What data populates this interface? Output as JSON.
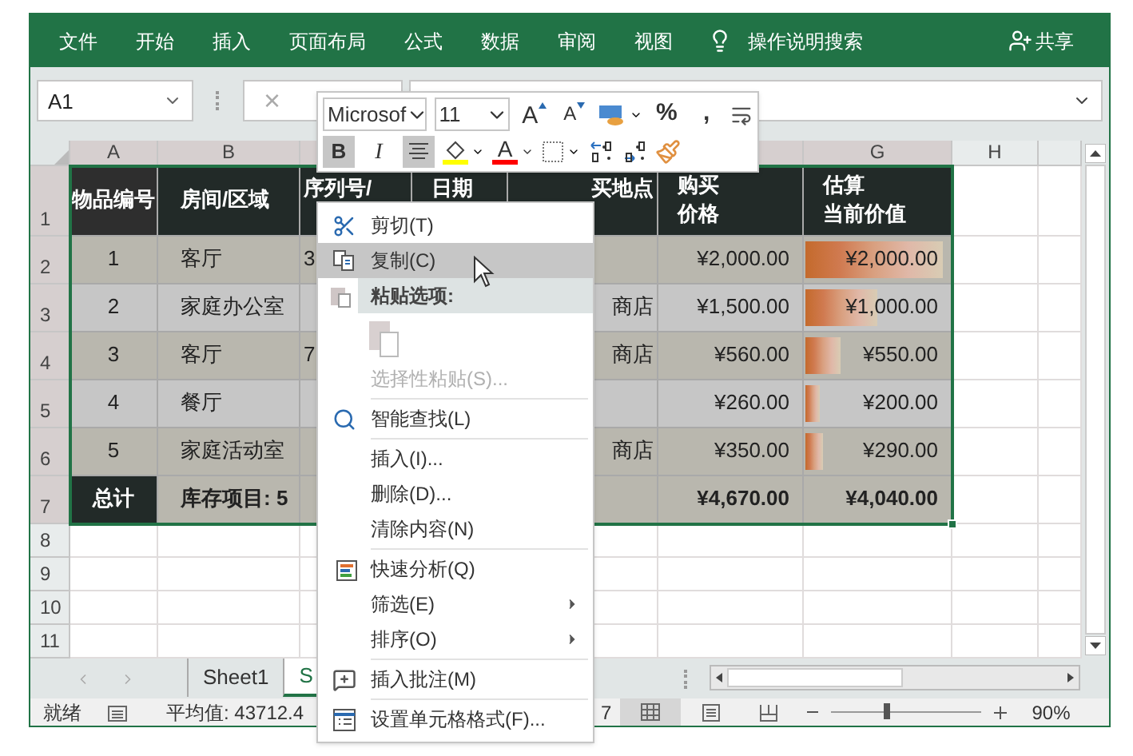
{
  "ribbon": {
    "tabs": [
      "文件",
      "开始",
      "插入",
      "页面布局",
      "公式",
      "数据",
      "审阅",
      "视图"
    ],
    "search": "操作说明搜索",
    "share": "共享"
  },
  "formula_bar": {
    "name_box": "A1",
    "cancel": "×"
  },
  "mini_toolbar": {
    "font": "Microsof",
    "size": "11",
    "row1": [
      {
        "kind": "grow",
        "text": "A"
      },
      {
        "kind": "shrink",
        "text": "A"
      },
      {
        "kind": "accounting"
      },
      {
        "kind": "text",
        "text": "%"
      },
      {
        "kind": "text",
        "text": ","
      },
      {
        "kind": "wrap"
      }
    ],
    "row2": [
      {
        "kind": "bold",
        "text": "B",
        "selected": true
      },
      {
        "kind": "italic",
        "text": "I",
        "selected": false
      },
      {
        "kind": "align",
        "selected": true
      },
      {
        "kind": "fill"
      },
      {
        "kind": "font_color",
        "text": "A"
      },
      {
        "kind": "border"
      },
      {
        "kind": "decrease_decimal"
      },
      {
        "kind": "increase_decimal"
      },
      {
        "kind": "painter"
      }
    ]
  },
  "sheet": {
    "column_headers": [
      "A",
      "B",
      "G",
      "H"
    ],
    "row_numbers": [
      "1",
      "2",
      "3",
      "4",
      "5",
      "6",
      "7",
      "8",
      "9",
      "10",
      "11"
    ],
    "table": {
      "header": {
        "item": "物品编号",
        "room": "房间/区域",
        "column_3": "序列号/",
        "column_4": "日期",
        "column_5": "买地点",
        "price": [
          "购买",
          "价格"
        ],
        "value": [
          "估算",
          "当前价值"
        ]
      },
      "rows": [
        {
          "kind": "data",
          "item": "1",
          "room": "客厅",
          "column_3": "3",
          "price": "¥2,000.00",
          "value": "¥2,000.00",
          "level": 1
        },
        {
          "kind": "data",
          "item": "2",
          "room": "家庭办公室",
          "column_5": "商店",
          "price": "¥1,500.00",
          "value": "¥1,000.00",
          "level": 0.52
        },
        {
          "kind": "data",
          "item": "3",
          "room": "客厅",
          "column_3": "7",
          "column_5": "商店",
          "price": "¥560.00",
          "value": "¥550.00",
          "level": 0.26
        },
        {
          "kind": "data",
          "item": "4",
          "room": "餐厅",
          "price": "¥260.00",
          "value": "¥200.00",
          "level": 0.1
        },
        {
          "kind": "data",
          "item": "5",
          "room": "家庭活动室",
          "column_5": "商店",
          "price": "¥350.00",
          "value": "¥290.00",
          "level": 0.13
        },
        {
          "kind": "total",
          "item": "总计",
          "room": "库存项目: 5",
          "price": "¥4,670.00",
          "value": "¥4,040.00"
        }
      ]
    }
  },
  "sheet_tabs": [
    {
      "label": "Sheet1",
      "selected": false
    },
    {
      "label": "S",
      "selected": true
    }
  ],
  "context_menu": [
    {
      "kind": "cut",
      "label": "剪切(T)",
      "selected": false,
      "disabled": false
    },
    {
      "kind": "copy",
      "label": "复制(C)",
      "selected": true,
      "disabled": false
    },
    {
      "kind": "paste_header",
      "label": "粘贴选项:"
    },
    {
      "kind": "paste_button",
      "disabled": true
    },
    {
      "kind": "plain",
      "label": "选择性粘贴(S)...",
      "selected": false,
      "disabled": true
    },
    {
      "kind": "separator"
    },
    {
      "kind": "lookup",
      "label": "智能查找(L)",
      "selected": false,
      "disabled": false
    },
    {
      "kind": "separator"
    },
    {
      "kind": "plain",
      "label": "插入(I)...",
      "selected": false,
      "disabled": false
    },
    {
      "kind": "plain",
      "label": "删除(D)...",
      "selected": false,
      "disabled": false
    },
    {
      "kind": "plain",
      "label": "清除内容(N)",
      "selected": false,
      "disabled": false
    },
    {
      "kind": "separator"
    },
    {
      "kind": "analysis",
      "label": "快速分析(Q)",
      "selected": false,
      "disabled": false
    },
    {
      "kind": "submenu",
      "label": "筛选(E)",
      "selected": false,
      "disabled": false
    },
    {
      "kind": "submenu",
      "label": "排序(O)",
      "selected": false,
      "disabled": false
    },
    {
      "kind": "separator"
    },
    {
      "kind": "comment",
      "label": "插入批注(M)",
      "selected": false,
      "disabled": false
    },
    {
      "kind": "separator"
    },
    {
      "kind": "format",
      "label": "设置单元格格式(F)...",
      "selected": false,
      "disabled": false
    }
  ],
  "status_bar": {
    "state": "就绪",
    "average": "平均值: 43712.4",
    "count": "7",
    "zoom": "90%",
    "level": 0.37
  }
}
